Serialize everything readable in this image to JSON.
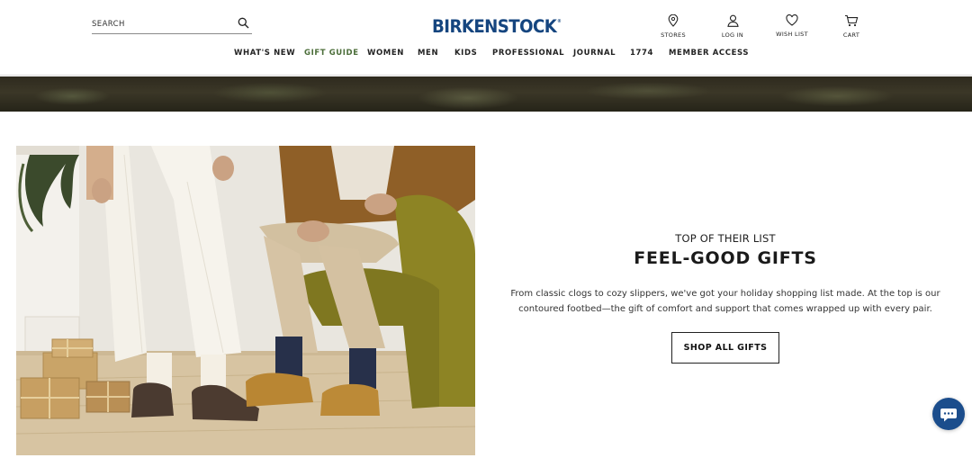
{
  "header": {
    "search": {
      "placeholder": "SEARCH",
      "value": ""
    },
    "logo": "BIRKENSTOCK",
    "utility": [
      {
        "label": "STORES",
        "icon": "map-pin-icon"
      },
      {
        "label": "LOG IN",
        "icon": "user-icon"
      },
      {
        "label": "WISH LIST",
        "icon": "heart-icon"
      },
      {
        "label": "CART",
        "icon": "cart-icon"
      }
    ]
  },
  "nav": {
    "items": [
      {
        "label": "WHAT'S NEW"
      },
      {
        "label": "GIFT GUIDE",
        "active": true
      },
      {
        "label": "WOMEN"
      },
      {
        "label": "MEN"
      },
      {
        "label": "KIDS"
      },
      {
        "label": "PROFESSIONAL"
      },
      {
        "label": "JOURNAL"
      },
      {
        "label": "1774"
      },
      {
        "label": "MEMBER ACCESS"
      }
    ]
  },
  "promo": {
    "eyebrow": "TOP OF THEIR LIST",
    "headline": "FEEL-GOOD GIFTS",
    "body": "From classic clogs to cozy slippers, we've got your holiday shopping list made. At the top is our contoured footbed—the gift of comfort and support that comes wrapped up with every pair.",
    "cta_label": "SHOP ALL GIFTS"
  },
  "chat": {
    "icon": "chat-icon"
  },
  "colors": {
    "brand": "#15457f",
    "active_nav": "#4c6e3a",
    "chat": "#1b4d8c"
  }
}
